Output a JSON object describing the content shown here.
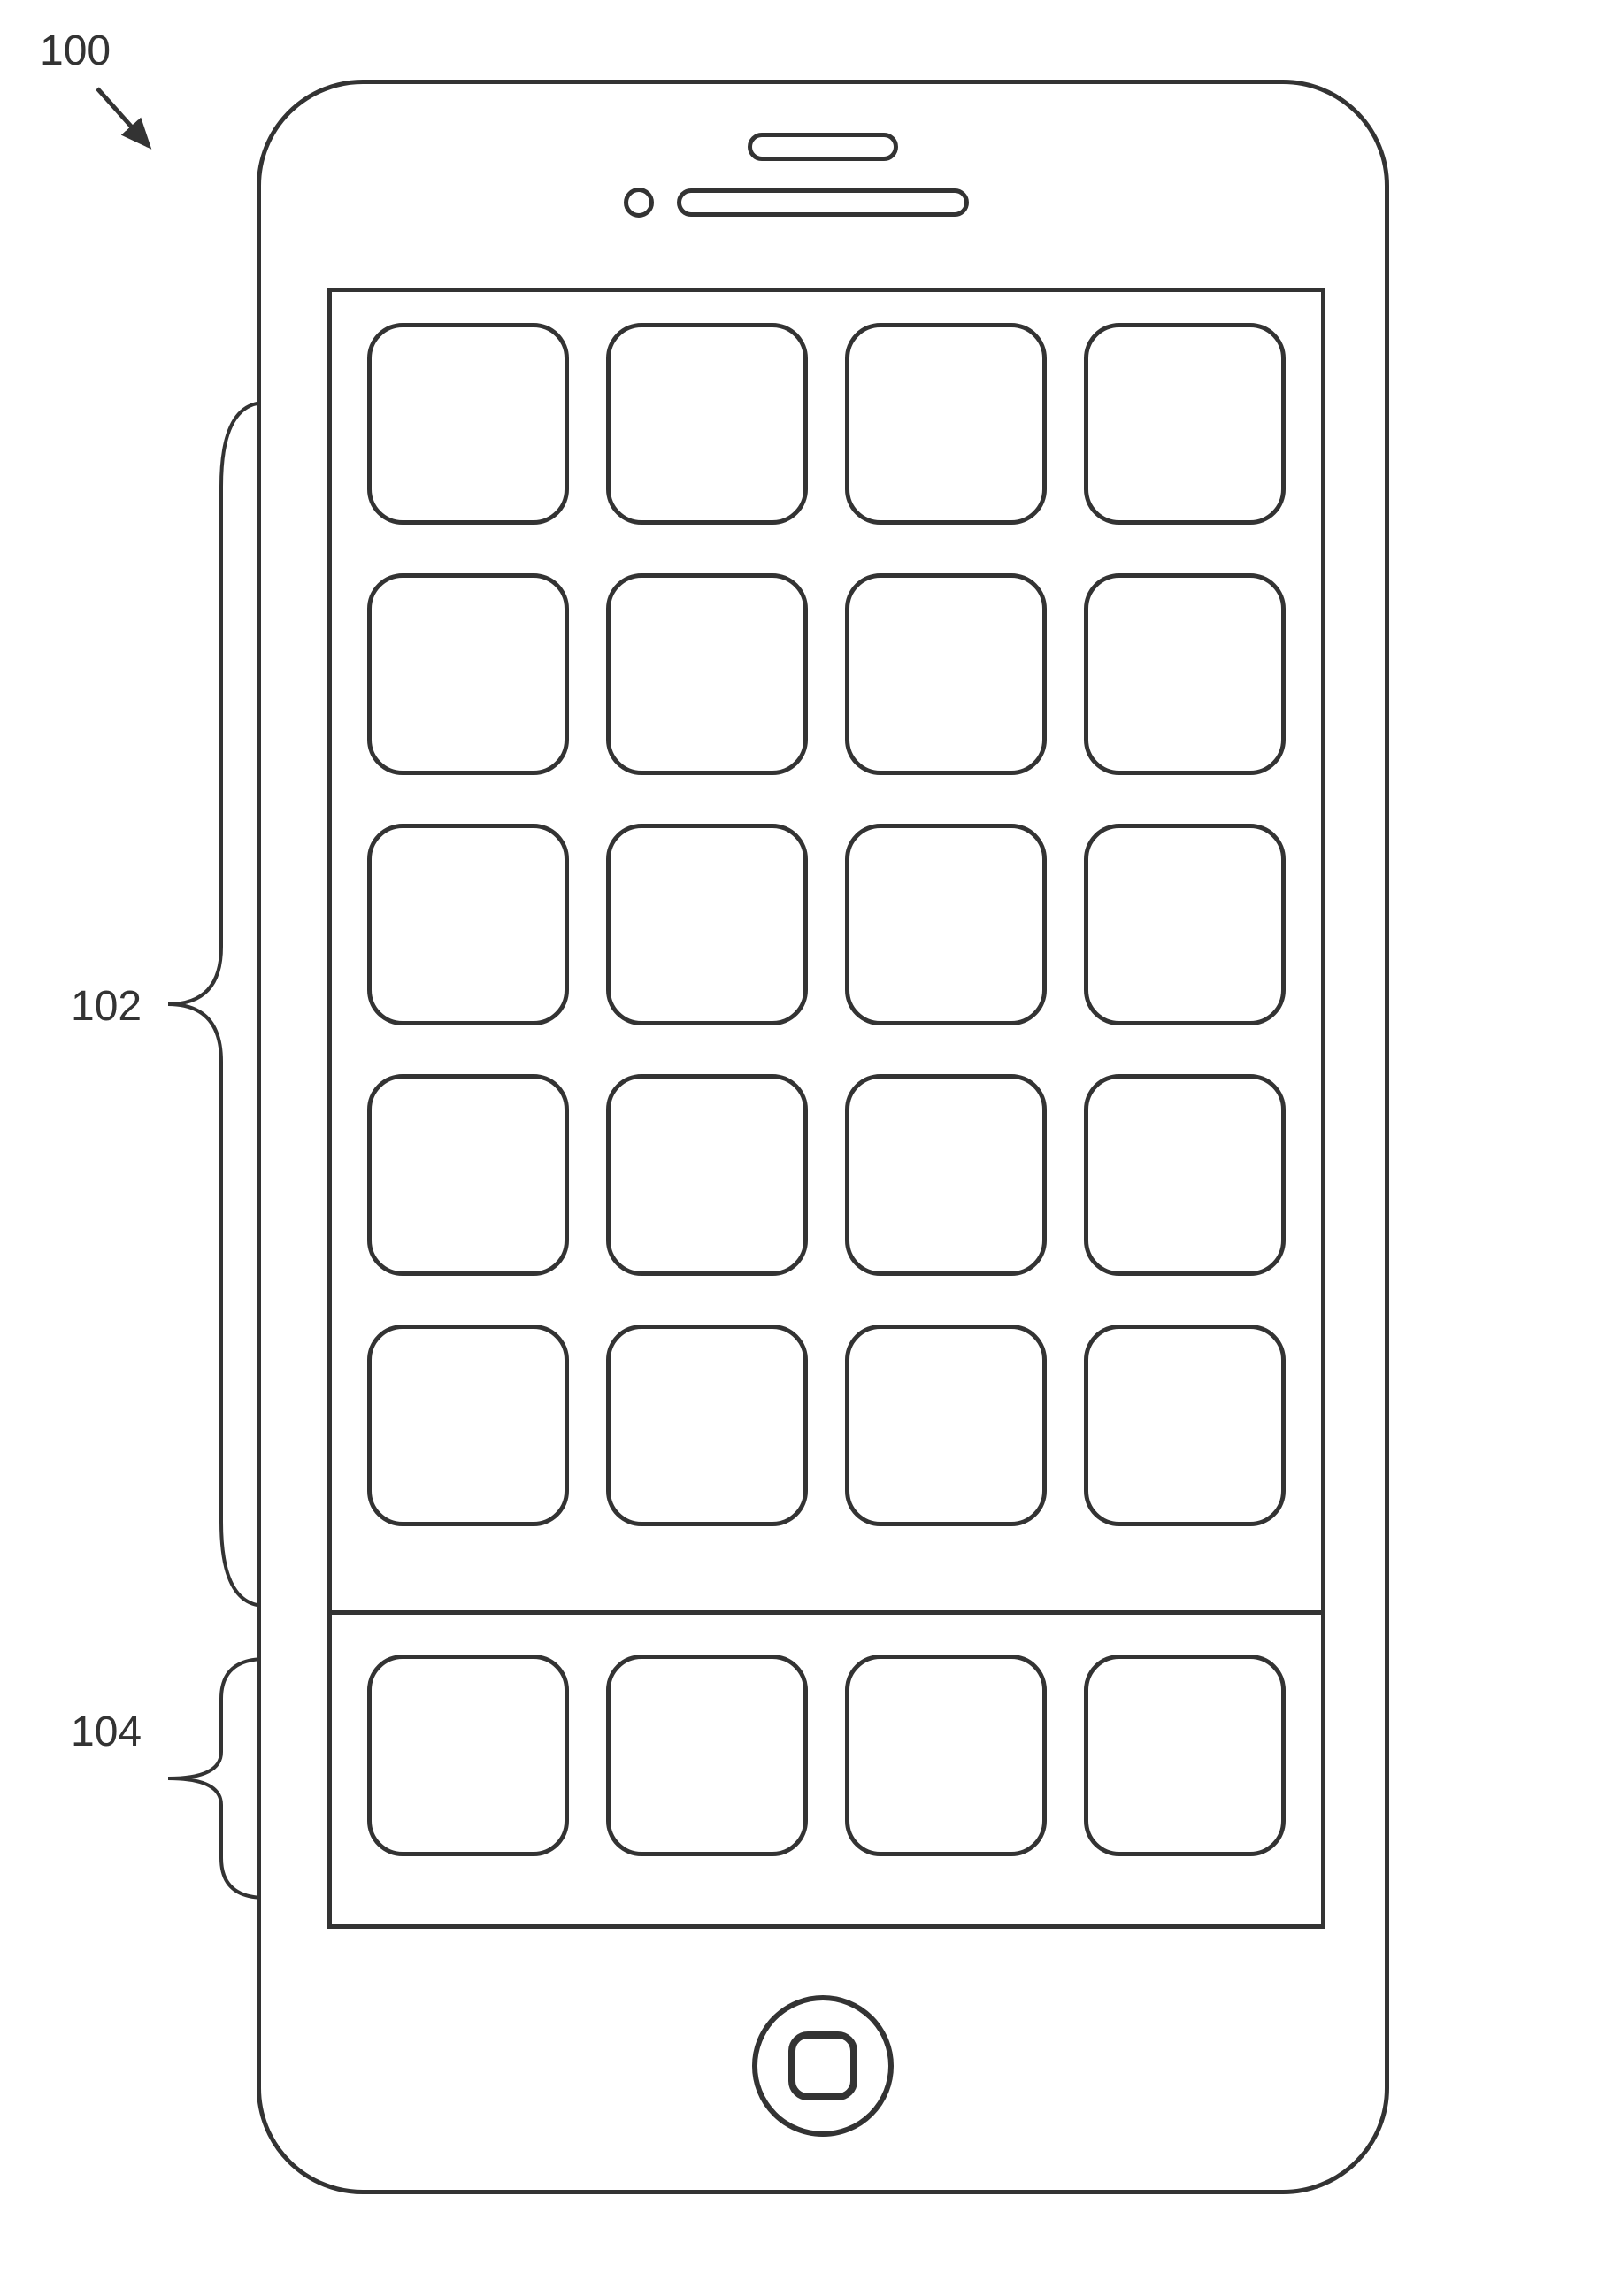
{
  "labels": {
    "figure_number": "100",
    "app_grid_ref": "102",
    "dock_ref": "104"
  },
  "layout": {
    "app_grid_rows": 5,
    "app_grid_cols": 4,
    "dock_cols": 4
  }
}
